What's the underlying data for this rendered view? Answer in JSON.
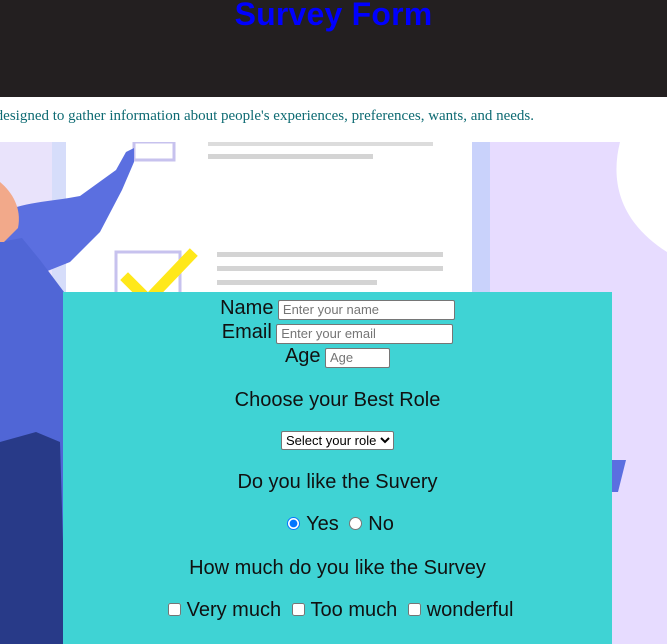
{
  "header": {
    "title": "Survey Form"
  },
  "description": "Survey Form is designed to gather information about people's experiences, preferences, wants, and needs.",
  "form": {
    "name": {
      "label": "Name",
      "placeholder": "Enter your name"
    },
    "email": {
      "label": "Email",
      "placeholder": "Enter your email"
    },
    "age": {
      "label": "Age",
      "placeholder": "Age"
    },
    "role_question": "Choose your Best Role",
    "role_select": {
      "selected": "Select your role"
    },
    "like_question": "Do you like the Suvery",
    "like_options": {
      "yes": "Yes",
      "no": "No",
      "selected": "Yes"
    },
    "how_much_question": "How much do you like the Survey",
    "how_much_options": [
      "Very much",
      "Too much",
      "wonderful"
    ]
  },
  "colors": {
    "header_bg": "#231f20",
    "title": "#0000ff",
    "description": "#0e6b73",
    "panel_bg": "#3fd3d4",
    "illustration_lavender": "#e7dcff",
    "figure_blue": "#5b6fe0",
    "check_yellow": "#ffe81a"
  }
}
